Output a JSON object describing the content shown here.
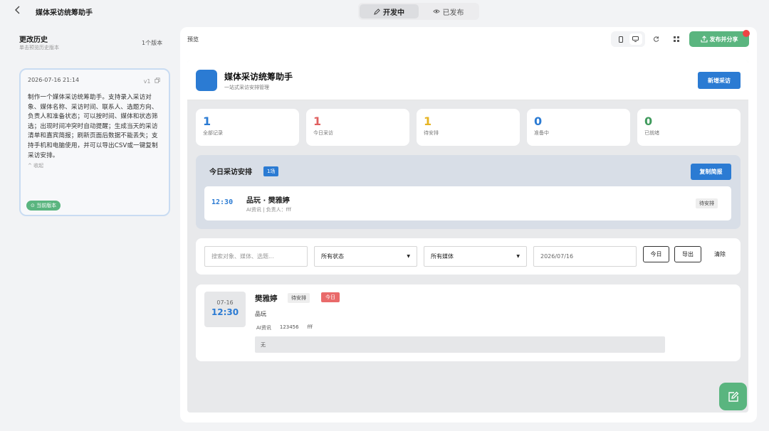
{
  "topbar": {
    "back_icon": "chevron-left-icon",
    "app_title": "媒体采访统筹助手",
    "tabs": [
      {
        "label": "开发中",
        "icon": "pencil-icon",
        "active": true
      },
      {
        "label": "已发布",
        "icon": "eye-icon",
        "active": false
      }
    ]
  },
  "history": {
    "title": "更改历史",
    "subtitle": "单击预览历史版本",
    "version_count": "1个版本",
    "card": {
      "datetime": "2026-07-16 21:14",
      "version": "v1",
      "description": "制作一个媒体采访统筹助手。支持录入采访对象、媒体名称、采访时间、联系人、选题方向、负责人和准备状态；可以按时间、媒体和状态筛选；出现时间冲突时自动提醒；生成当天的采访清单和嘉宾简报；刷新页面后数据不能丢失；支持手机和电脑使用，并可以导出CSV或一键复制采访安排。",
      "collapse_label": "^ 收起",
      "current_badge": "⊙ 当前版本"
    }
  },
  "preview": {
    "label": "预览",
    "publish_label": "发布并分享",
    "app": {
      "title": "媒体采访统筹助手",
      "subtitle": "一站式采访安排管理",
      "new_button": "新增采访",
      "stats": [
        {
          "value": "1",
          "label": "全部记录",
          "color": "#2b7bd3"
        },
        {
          "value": "1",
          "label": "今日采访",
          "color": "#e06060"
        },
        {
          "value": "1",
          "label": "待安排",
          "color": "#e6b422"
        },
        {
          "value": "0",
          "label": "准备中",
          "color": "#2b7bd3"
        },
        {
          "value": "0",
          "label": "已就绪",
          "color": "#3f9a5c"
        }
      ],
      "today": {
        "title": "今日采访安排",
        "count": "1场",
        "copy_button": "复制简报",
        "item": {
          "time": "12:30",
          "name": "品玩 · 樊雅婷",
          "meta": "AI资讯 | 负责人：fff",
          "status": "待安排"
        }
      },
      "filters": {
        "search_placeholder": "搜索对象、媒体、选题...",
        "status_select": "所有状态",
        "media_select": "所有媒体",
        "date": "2026/07/16",
        "today_button": "今日",
        "export_button": "导出",
        "clear_button": "清除"
      },
      "record": {
        "date": "07-16",
        "time": "12:30",
        "name": "樊雅婷",
        "status": "待安排",
        "today_tag": "今日",
        "media": "品玩",
        "topic": "AI资讯",
        "contact": "123456",
        "owner": "fff",
        "note": "无"
      }
    }
  },
  "colors": {
    "accent_blue": "#2b7bd3",
    "accent_green": "#5ab57f",
    "alert_red": "#e96a6a"
  }
}
